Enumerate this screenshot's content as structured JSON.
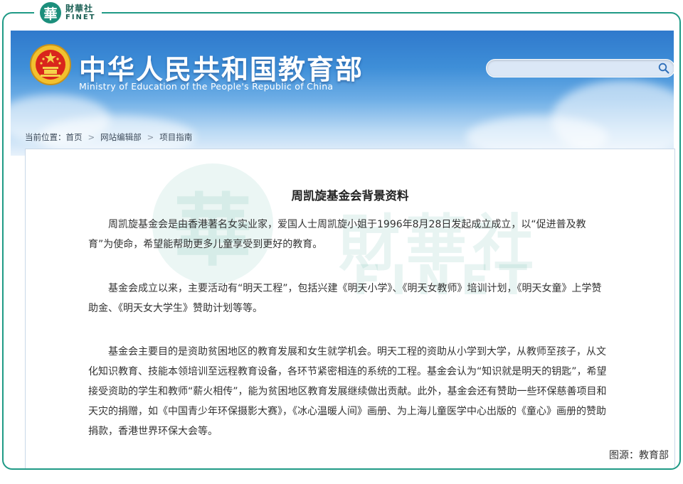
{
  "badge": {
    "char": "華",
    "name_zh": "財華社",
    "name_en": "FINET"
  },
  "header": {
    "title_zh": "中华人民共和国教育部",
    "title_en": "Ministry of Education of the People's Republic of China",
    "search": {
      "value": "",
      "placeholder": ""
    },
    "sky_color": "#3f8fd8"
  },
  "breadcrumb": {
    "prefix": "当前位置：",
    "items": [
      "首页",
      "网站编辑部",
      "项目指南"
    ],
    "separator": ">"
  },
  "watermark": {
    "char": "華",
    "zh": "財華社",
    "en": "FINET"
  },
  "article": {
    "title": "周凯旋基金会背景资料",
    "paragraphs": [
      "周凯旋基金会是由香港著名女实业家，爱国人士周凯旋小姐于1996年8月28日发起成立成立，以“促进普及教育”为使命，希望能帮助更多儿童享受到更好的教育。",
      "基金会成立以来，主要活动有“明天工程”，包括兴建《明天小学》、《明天女教师》培训计划，《明天女童》上学赞助金、《明天女大学生》赞助计划等等。",
      "基金会主要目的是资助贫困地区的教育发展和女生就学机会。明天工程的资助从小学到大学，从教师至孩子，从文化知识教育、技能本领培训至远程教育设备，各环节紧密相连的系统的工程。基金会认为“知识就是明天的钥匙”，希望接受资助的学生和教师“薪火相传”，能为贫困地区教育发展继续做出贡献。此外，基金会还有赞助一些环保慈善项目和天灾的捐赠，如《中国青少年环保摄影大赛》，《冰心温暖人间》画册、为上海儿童医学中心出版的《童心》画册的赞助捐款，香港世界环保大会等。"
    ],
    "source": "图源：教育部"
  },
  "colors": {
    "frame": "#1f9a86",
    "brand": "#1c8f7c"
  }
}
